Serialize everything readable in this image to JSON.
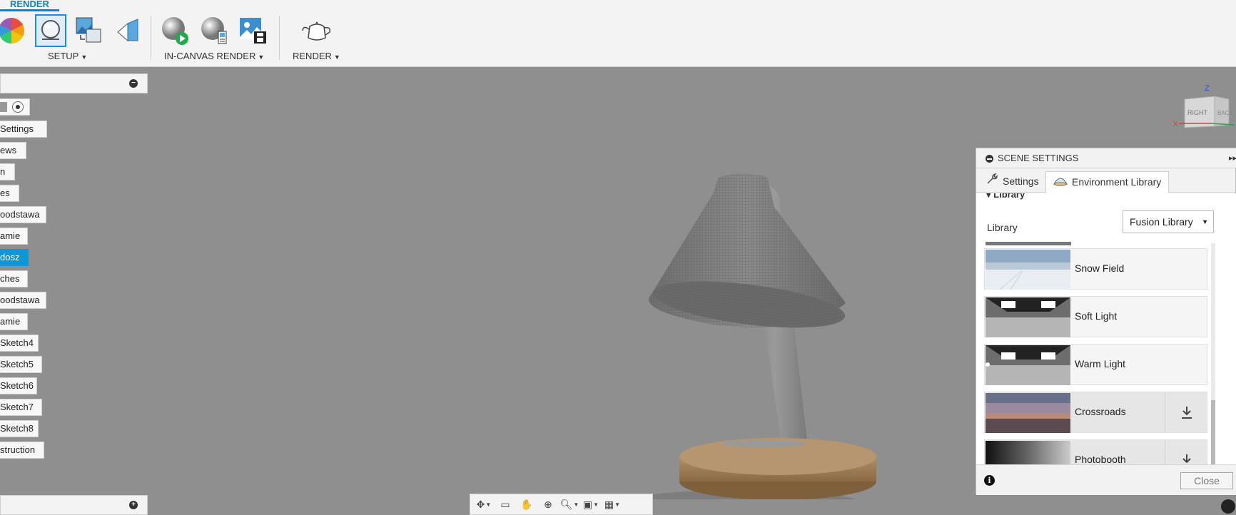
{
  "ribbon": {
    "tab": "RENDER",
    "groups": [
      {
        "label": "SETUP"
      },
      {
        "label": "IN-CANVAS RENDER"
      },
      {
        "label": "RENDER"
      }
    ],
    "tools": [
      "color-wheel-icon",
      "scene-settings-icon",
      "texture-map-icon",
      "decal-icon",
      "in-canvas-render-icon",
      "render-settings-icon",
      "capture-image-icon",
      "teapot-icon"
    ]
  },
  "browser": {
    "items": [
      {
        "label": "Settings"
      },
      {
        "label": "ews"
      },
      {
        "label": "n"
      },
      {
        "label": "es"
      },
      {
        "label": "oodstawa"
      },
      {
        "label": "amie"
      },
      {
        "label": "dosz",
        "selected": true
      },
      {
        "label": "ches"
      },
      {
        "label": "oodstawa"
      },
      {
        "label": "amie"
      },
      {
        "label": "Sketch4"
      },
      {
        "label": "Sketch5"
      },
      {
        "label": "Sketch6"
      },
      {
        "label": "Sketch7"
      },
      {
        "label": "Sketch8"
      },
      {
        "label": "struction"
      }
    ]
  },
  "viewcube": {
    "top": "Z",
    "front": "RIGHT",
    "side": "BACK",
    "axis_x": "X"
  },
  "scene_settings": {
    "title": "SCENE SETTINGS",
    "tabs": [
      {
        "label": "Settings"
      },
      {
        "label": "Environment Library",
        "active": true
      }
    ],
    "section": "Library",
    "library_label": "Library",
    "library_value": "Fusion Library",
    "environments": [
      {
        "name": "Snow Field",
        "download": false
      },
      {
        "name": "Soft Light",
        "download": false
      },
      {
        "name": "Warm Light",
        "download": false
      },
      {
        "name": "Crossroads",
        "download": true
      },
      {
        "name": "Photobooth",
        "download": true
      }
    ],
    "close_label": "Close"
  },
  "colors": {
    "accent": "#0d96d8",
    "viewport": "#8f8f8f",
    "panel": "#f3f3f3"
  }
}
